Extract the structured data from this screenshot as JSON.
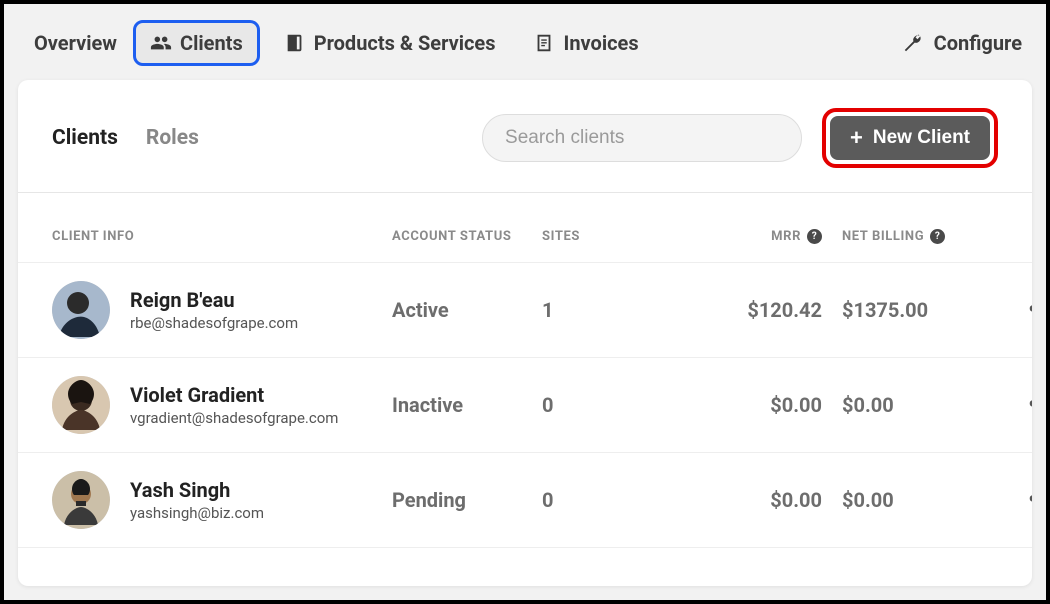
{
  "nav": {
    "overview": "Overview",
    "clients": "Clients",
    "products": "Products & Services",
    "invoices": "Invoices",
    "configure": "Configure"
  },
  "tabs": {
    "clients": "Clients",
    "roles": "Roles"
  },
  "search": {
    "placeholder": "Search clients"
  },
  "new_client": {
    "label": "New Client"
  },
  "columns": {
    "client_info": "CLIENT INFO",
    "account_status": "ACCOUNT STATUS",
    "sites": "SITES",
    "mrr": "MRR",
    "net_billing": "NET BILLING"
  },
  "rows": [
    {
      "name": "Reign B'eau",
      "email": "rbe@shadesofgrape.com",
      "status": "Active",
      "sites": "1",
      "mrr": "$120.42",
      "net_billing": "$1375.00"
    },
    {
      "name": "Violet Gradient",
      "email": "vgradient@shadesofgrape.com",
      "status": "Inactive",
      "sites": "0",
      "mrr": "$0.00",
      "net_billing": "$0.00"
    },
    {
      "name": "Yash Singh",
      "email": "yashsingh@biz.com",
      "status": "Pending",
      "sites": "0",
      "mrr": "$0.00",
      "net_billing": "$0.00"
    }
  ]
}
